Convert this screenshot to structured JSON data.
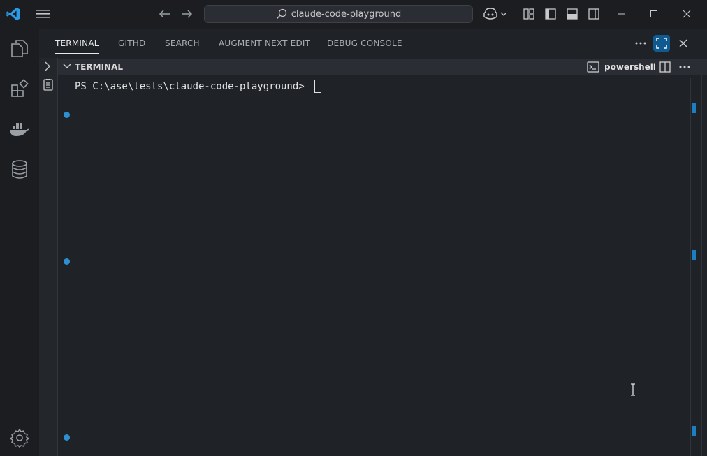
{
  "titlebar": {
    "search_text": "claude-code-playground",
    "icons": [
      "vscode-logo-icon",
      "menu-icon",
      "back-arrow-icon",
      "forward-arrow-icon",
      "search-icon",
      "copilot-icon",
      "chevron-down-icon",
      "customize-layout-icon",
      "toggle-sidebar-icon",
      "toggle-panel-icon",
      "toggle-secondary-sidebar-icon",
      "minimize-icon",
      "maximize-icon",
      "close-icon"
    ]
  },
  "activity_bar": {
    "items": [
      {
        "name": "explorer",
        "icon": "files-icon"
      },
      {
        "name": "extensions",
        "icon": "extensions-icon"
      },
      {
        "name": "docker",
        "icon": "docker-icon"
      },
      {
        "name": "database",
        "icon": "database-icon"
      }
    ],
    "settings_icon": "gear-icon"
  },
  "panel": {
    "tabs": [
      {
        "label": "TERMINAL",
        "active": true
      },
      {
        "label": "GITHD",
        "active": false
      },
      {
        "label": "SEARCH",
        "active": false
      },
      {
        "label": "AUGMENT NEXT EDIT",
        "active": false
      },
      {
        "label": "DEBUG CONSOLE",
        "active": false
      }
    ]
  },
  "terminal": {
    "section_title": "TERMINAL",
    "shell_name": "powershell",
    "prompt": "PS C:\\ase\\tests\\claude-code-playground> "
  },
  "colors": {
    "accent": "#1c7fc2",
    "background": "#1f2227",
    "titlebar": "#1b1d21",
    "maximize_button": "#0f5a91"
  }
}
